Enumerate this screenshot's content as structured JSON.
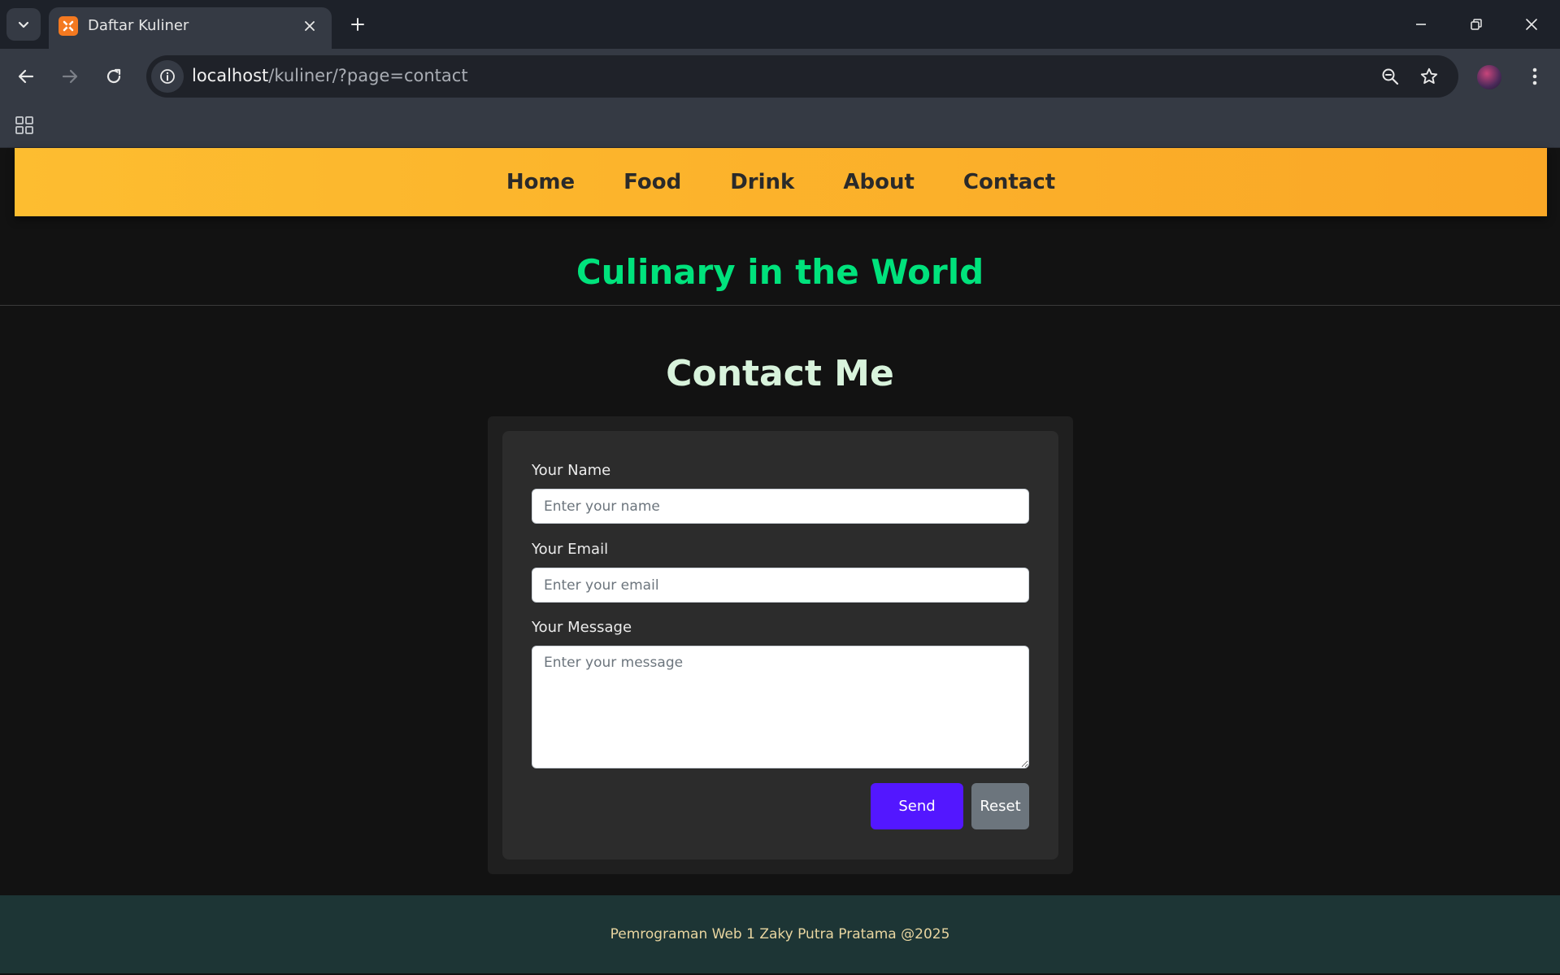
{
  "browser": {
    "tab_title": "Daftar Kuliner",
    "url_host": "localhost",
    "url_path": "/kuliner/?page=contact"
  },
  "nav": {
    "items": [
      "Home",
      "Food",
      "Drink",
      "About",
      "Contact"
    ]
  },
  "site_title": "Culinary in the World",
  "contact": {
    "title": "Contact Me",
    "name_label": "Your Name",
    "name_placeholder": "Enter your name",
    "email_label": "Your Email",
    "email_placeholder": "Enter your email",
    "message_label": "Your Message",
    "message_placeholder": "Enter your message",
    "send_label": "Send",
    "reset_label": "Reset"
  },
  "footer": {
    "text": "Pemrograman Web 1 Zaky Putra Pratama @2025"
  },
  "colors": {
    "nav_bg_start": "#fdbd30",
    "nav_bg_end": "#faa726",
    "site_title": "#00e27c",
    "send_button": "#5317ff",
    "reset_button": "#6c757d",
    "footer_bg": "#1d3535"
  }
}
